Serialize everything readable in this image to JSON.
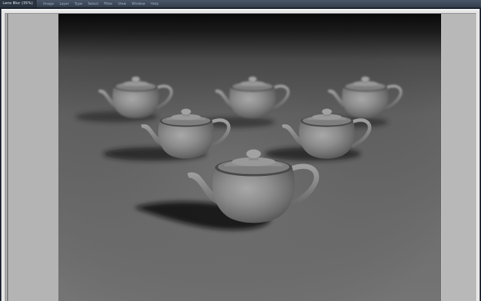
{
  "window": {
    "document_title": "Lens Blur (35%)"
  },
  "menubar": {
    "items": [
      "Image",
      "Layer",
      "Type",
      "Select",
      "Filter",
      "View",
      "Window",
      "Help"
    ]
  },
  "preview": {
    "scene": "teapots",
    "teapot_count": 6
  },
  "colors": {
    "menubar": "#3a4555",
    "frame": "#e6e6e6",
    "side_panel": "#b4b4b4",
    "floor": "#6b6b6b",
    "teapot": "#8c8c8c"
  }
}
